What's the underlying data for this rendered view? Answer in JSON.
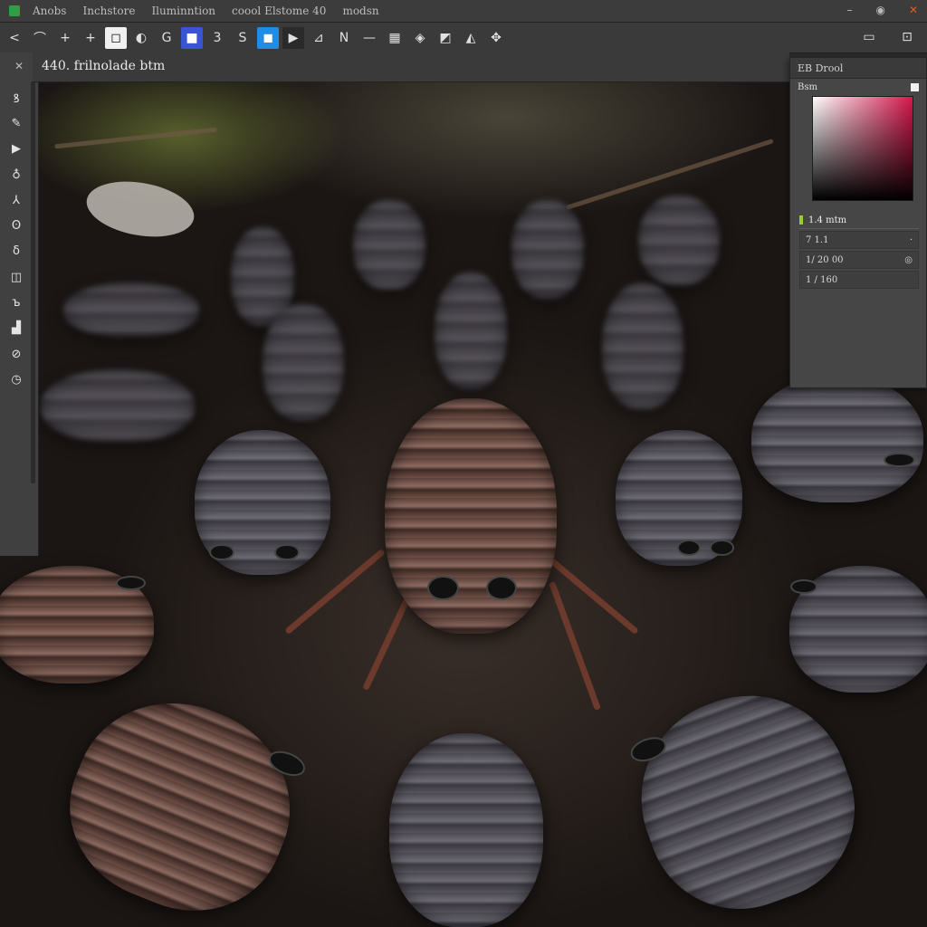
{
  "titlebar": {
    "menu": [
      "Anobs",
      "Inchstore",
      "Iluminntion",
      "coool Elstome 40",
      "modsn"
    ],
    "controls": [
      "–",
      "◉",
      "✕"
    ]
  },
  "toolbar": {
    "buttons": [
      "<",
      "⌒",
      "+",
      "+",
      "◻",
      "◐",
      "G",
      "■",
      "3",
      "S",
      "◼",
      "▶",
      "⊿",
      "N",
      "—",
      "▦",
      "◈",
      "◩",
      "◭",
      "✥"
    ],
    "right_buttons": [
      "▭",
      "⊡"
    ]
  },
  "document": {
    "tab_title": "440. frilnolade btm"
  },
  "leftbar": {
    "header": "✕",
    "tools": [
      "ꝸ",
      "✎",
      "▶",
      "♁",
      "⅄",
      "ʘ",
      "δ",
      "◫",
      "ъ",
      "▟",
      "⊘",
      "◷"
    ]
  },
  "panel": {
    "title": "EB Drool",
    "subtitle": "Bsm",
    "colors": {
      "hue": "#d4164a"
    },
    "layers_title": "1.4 mtm",
    "rows": [
      {
        "label": "7 1.1",
        "mark": "·"
      },
      {
        "label": "1/ 20 00",
        "mark": "◎"
      },
      {
        "label": "1 / 160",
        "mark": ""
      }
    ]
  }
}
